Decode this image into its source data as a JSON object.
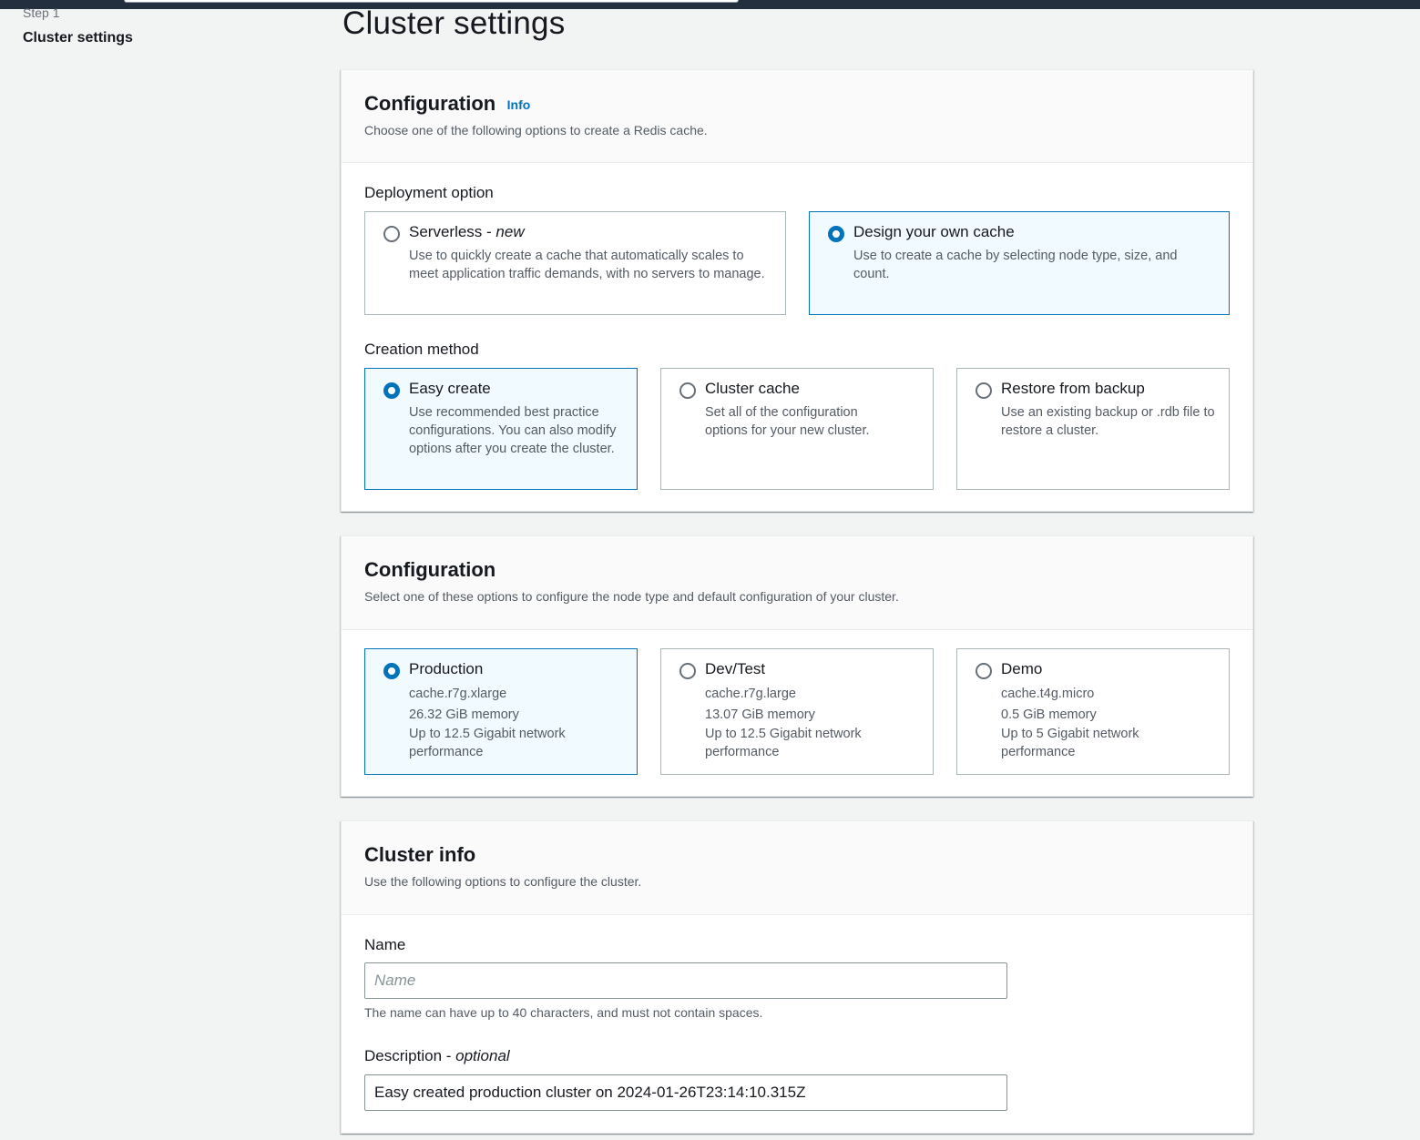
{
  "sidebar": {
    "step_label": "Step 1",
    "step_title": "Cluster settings"
  },
  "page": {
    "title": "Cluster settings"
  },
  "panel_config_1": {
    "title": "Configuration",
    "info": "Info",
    "description": "Choose one of the following options to create a Redis cache.",
    "deployment_label": "Deployment option",
    "deployment_options": [
      {
        "title": "Serverless - ",
        "title_italic": "new",
        "description": "Use to quickly create a cache that automatically scales to meet application traffic demands, with no servers to manage.",
        "selected": false
      },
      {
        "title": "Design your own cache",
        "description": "Use to create a cache by selecting node type, size, and count.",
        "selected": true
      }
    ],
    "creation_label": "Creation method",
    "creation_options": [
      {
        "title": "Easy create",
        "description": "Use recommended best practice configurations. You can also modify options after you create the cluster.",
        "selected": true
      },
      {
        "title": "Cluster cache",
        "description": "Set all of the configuration options for your new cluster.",
        "selected": false
      },
      {
        "title": "Restore from backup",
        "description": "Use an existing backup or .rdb file to restore a cluster.",
        "selected": false
      }
    ]
  },
  "panel_config_2": {
    "title": "Configuration",
    "description": "Select one of these options to configure the node type and default configuration of your cluster.",
    "options": [
      {
        "title": "Production",
        "node_type": "cache.r7g.xlarge",
        "memory": "26.32 GiB memory",
        "network": "Up to 12.5 Gigabit network performance",
        "selected": true
      },
      {
        "title": "Dev/Test",
        "node_type": "cache.r7g.large",
        "memory": "13.07 GiB memory",
        "network": "Up to 12.5 Gigabit network performance",
        "selected": false
      },
      {
        "title": "Demo",
        "node_type": "cache.t4g.micro",
        "memory": "0.5 GiB memory",
        "network": "Up to 5 Gigabit network performance",
        "selected": false
      }
    ]
  },
  "panel_cluster_info": {
    "title": "Cluster info",
    "description": "Use the following options to configure the cluster.",
    "name_label": "Name",
    "name_placeholder": "Name",
    "name_value": "",
    "name_hint": "The name can have up to 40 characters, and must not contain spaces.",
    "description_label": "Description - ",
    "description_label_italic": "optional",
    "description_value": "Easy created production cluster on 2024-01-26T23:14:10.315Z"
  },
  "colors": {
    "accent": "#0073bb",
    "selected_tile_bg": "#f1faff",
    "topbar": "#232f3e"
  }
}
